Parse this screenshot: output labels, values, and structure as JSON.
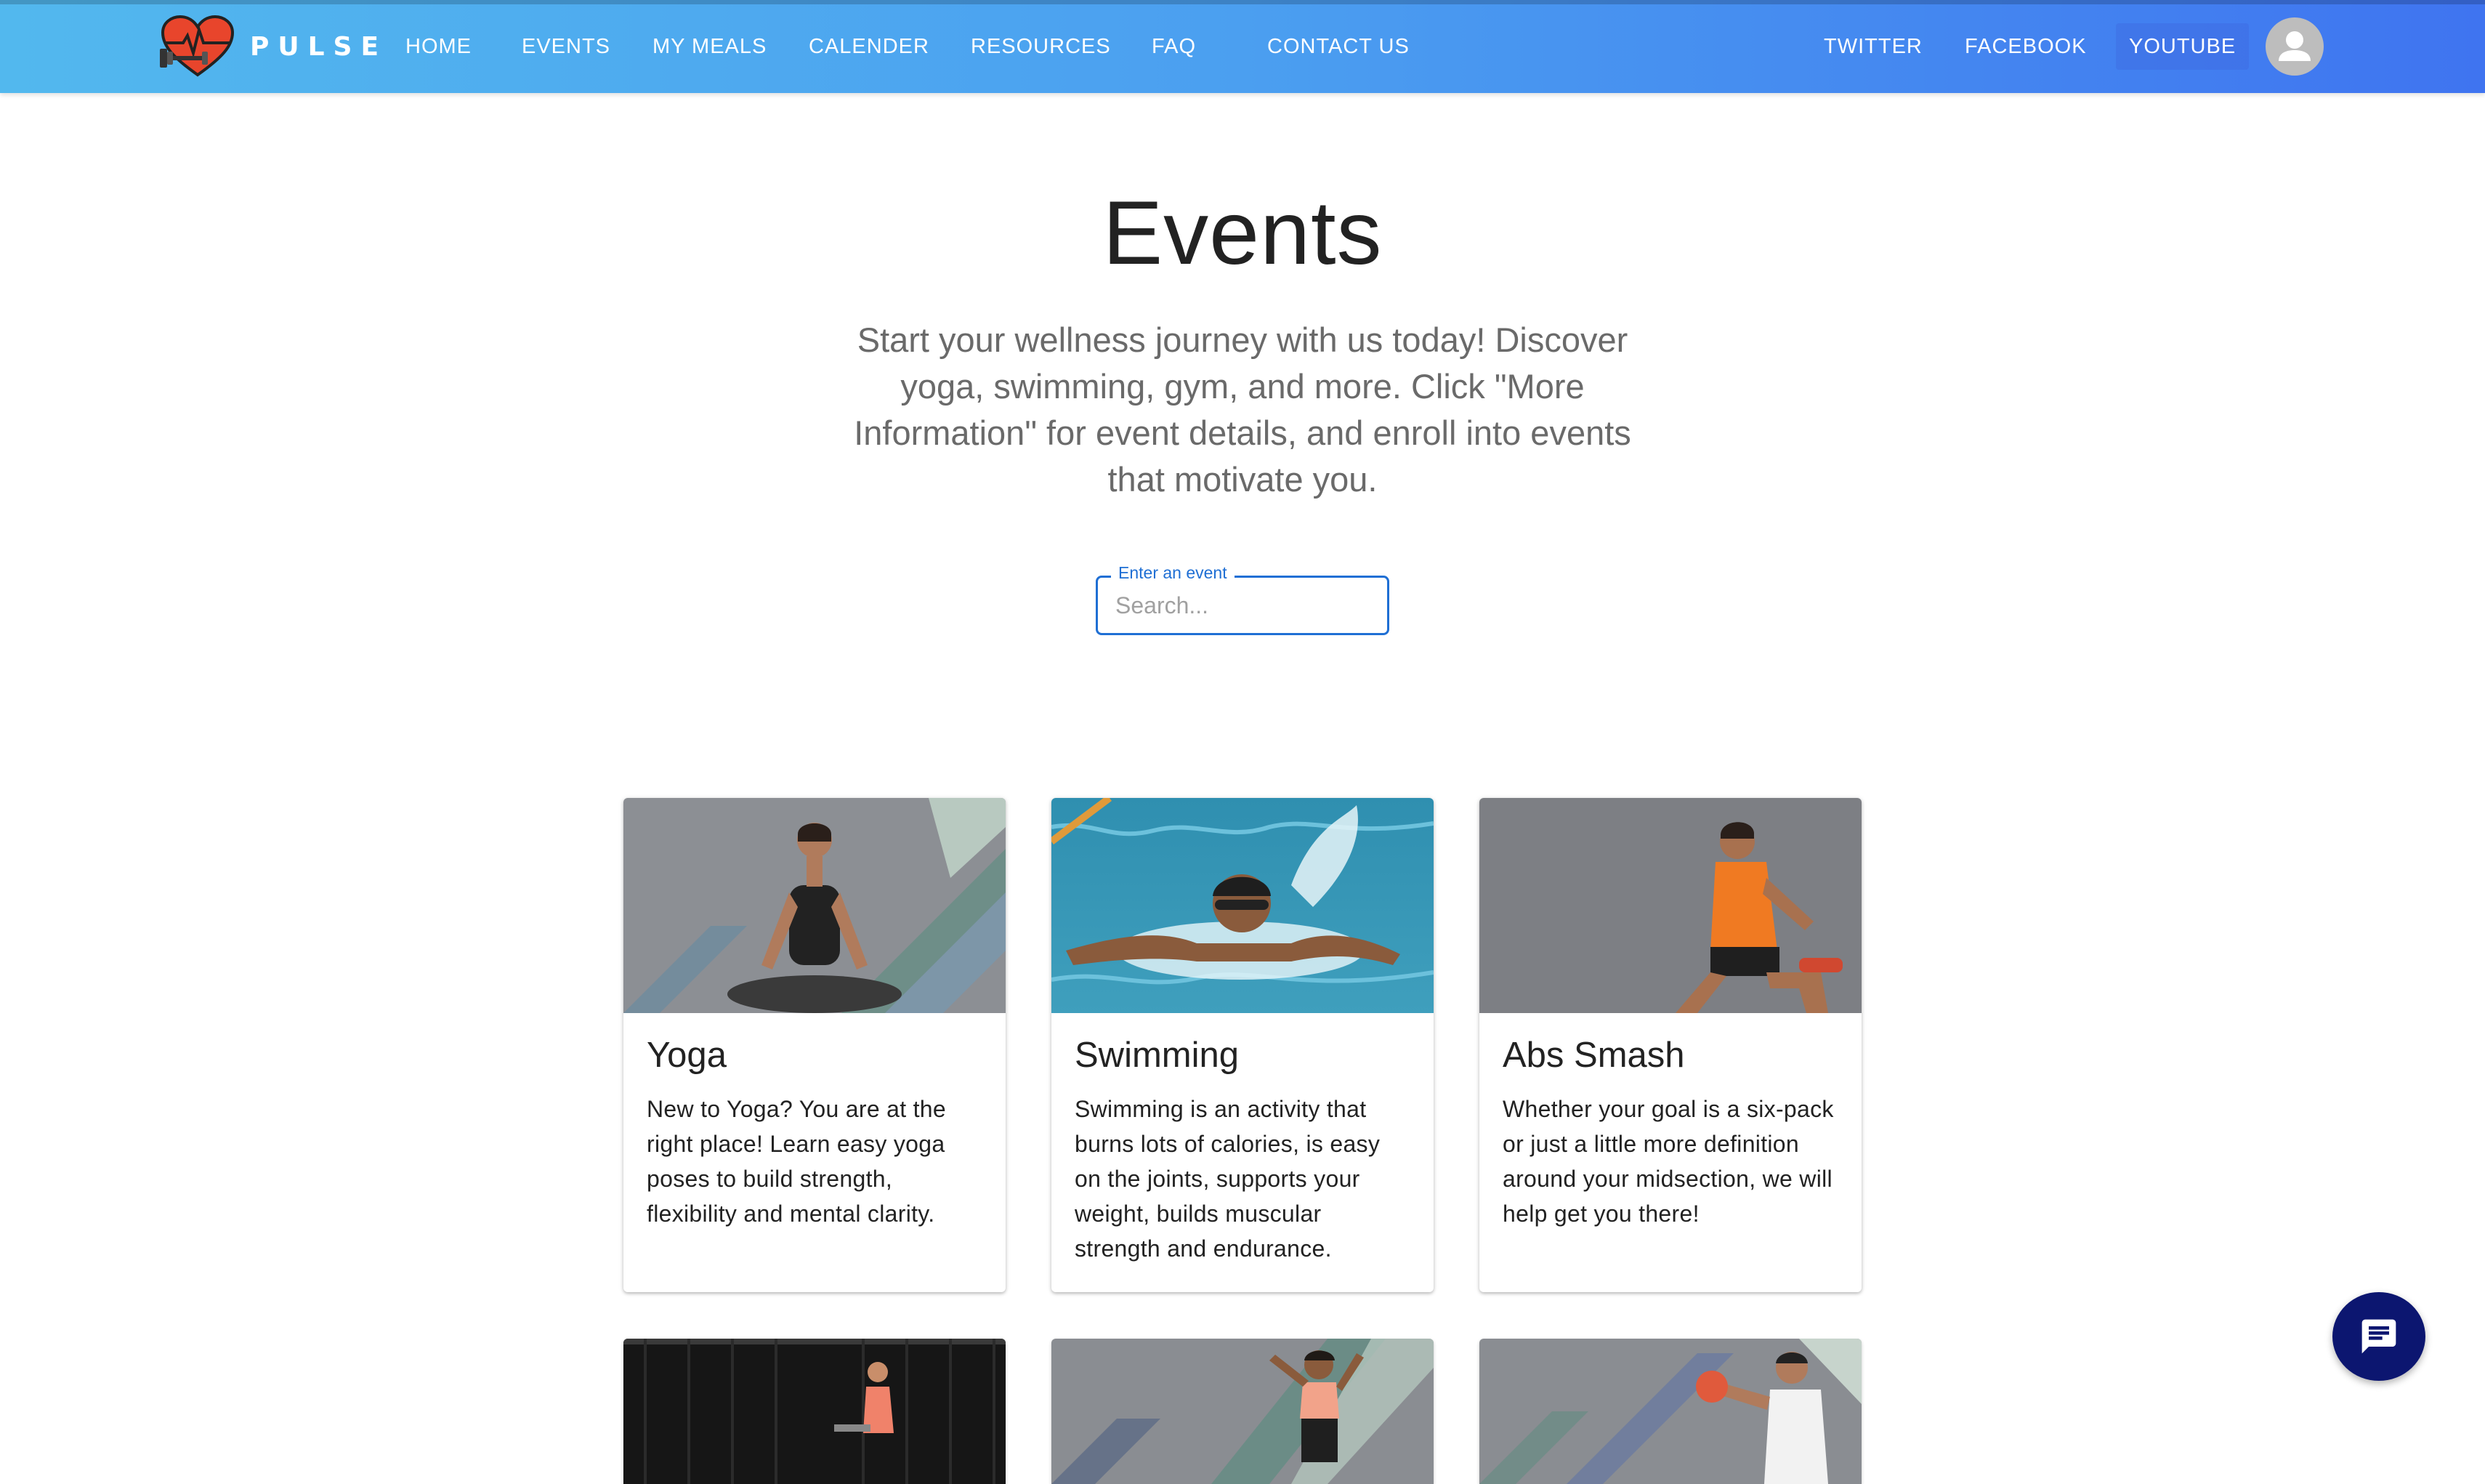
{
  "brand": {
    "name": "PULSE",
    "logo_icon": "heart-dumbbell-icon"
  },
  "nav": {
    "links": [
      "HOME",
      "EVENTS",
      "MY MEALS",
      "CALENDER",
      "RESOURCES",
      "FAQ",
      "CONTACT US"
    ],
    "social": [
      "TWITTER",
      "FACEBOOK",
      "YOUTUBE"
    ],
    "avatar_icon": "user-avatar-icon"
  },
  "hero": {
    "title": "Events",
    "intro": "Start your wellness journey with us today! Discover yoga, swimming, gym, and more. Click \"More Information\" for event details, and enroll into events that motivate you."
  },
  "search": {
    "label": "Enter an event",
    "placeholder": "Search...",
    "value": ""
  },
  "cards": [
    {
      "title": "Yoga",
      "description": "New to Yoga? You are at the right place! Learn easy yoga poses to build strength, flexibility and mental clarity.",
      "image": "yoga-photo"
    },
    {
      "title": "Swimming",
      "description": "Swimming is an activity that burns lots of calories, is easy on the joints, supports your weight, builds muscular strength and endurance.",
      "image": "swimming-photo"
    },
    {
      "title": "Abs Smash",
      "description": "Whether your goal is a six-pack or just a little more definition around your midsection, we will help get you there!",
      "image": "abs-photo"
    }
  ],
  "partial_cards": [
    {
      "image": "treadmill-photo"
    },
    {
      "image": "dance-photo"
    },
    {
      "image": "boxing-photo"
    }
  ],
  "chat": {
    "icon": "chat-icon"
  },
  "colors": {
    "nav_gradient_start": "#52b8ee",
    "nav_gradient_end": "#3f74f0",
    "search_accent": "#1f6fd4",
    "chat_fab": "#0c1670"
  }
}
